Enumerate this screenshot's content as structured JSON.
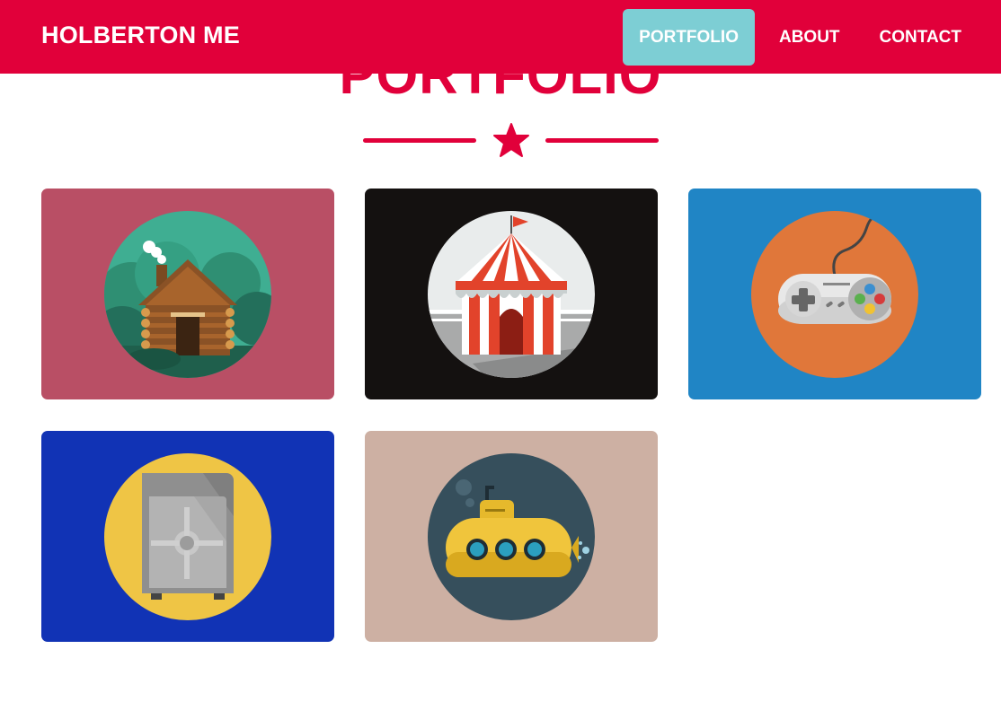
{
  "navbar": {
    "brand": "HOLBERTON ME",
    "links": [
      "PORTFOLIO",
      "ABOUT",
      "CONTACT"
    ],
    "color": "#e1003a",
    "active_color": "#7dced4"
  },
  "portfolio": {
    "title": "PORTFOLIO",
    "divider_icon": "star-icon",
    "items": [
      {
        "icon": "cabin-icon",
        "bg": "#b94f65",
        "circle": "#3fae92"
      },
      {
        "icon": "circus-tent-icon",
        "bg": "#141110",
        "circle": "#e9ecec"
      },
      {
        "icon": "game-controller-icon",
        "bg": "#2085c5",
        "circle": "#e0773a"
      },
      {
        "icon": "safe-icon",
        "bg": "#1133b5",
        "circle": "#efc545"
      },
      {
        "icon": "submarine-icon",
        "bg": "#cdb0a3",
        "circle": "#364f5c"
      }
    ]
  }
}
